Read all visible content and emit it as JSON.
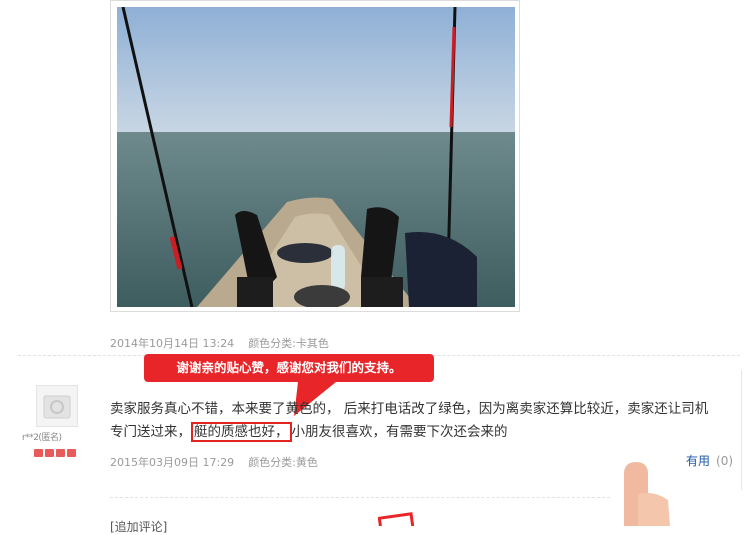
{
  "review1": {
    "date": "2014年10月14日 13:24",
    "color_label": "颜色分类:卡其色"
  },
  "bubble": {
    "text": "谢谢亲的贴心赞，感谢您对我们的支持。"
  },
  "review2": {
    "user_name": "r**2(匿名)",
    "text_line1": "卖家服务真心不错，本来要了黄色的，   后来打电话改了绿色，因为离卖家还算比较近，卖家还让司机",
    "text_line2_pre": "专门送过来，",
    "text_highlight": "艇的质感也好，",
    "text_line2_post": "小朋友很喜欢，有需要下次还会来的",
    "date": "2015年03月09日 17:29",
    "color_label": "颜色分类:黄色",
    "useful_label": "有用",
    "useful_count": "(0)"
  },
  "review3": {
    "partial_text": "[追加评论]"
  },
  "colors": {
    "accent_red": "#e8262a",
    "link_blue": "#1d5aa6",
    "meta_gray": "#9a9a9a"
  }
}
